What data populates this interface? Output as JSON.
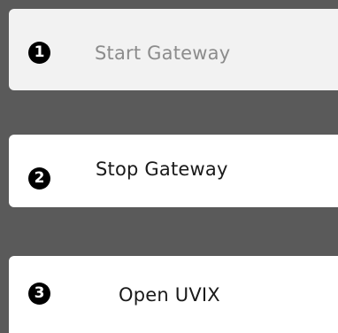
{
  "buttons": [
    {
      "badge": "1",
      "label": "Start Gateway",
      "state": "disabled"
    },
    {
      "badge": "2",
      "label": "Stop Gateway",
      "state": "enabled"
    },
    {
      "badge": "3",
      "label": "Open UVIX",
      "state": "enabled"
    }
  ],
  "colors": {
    "background": "#5a5a5a",
    "button_disabled_bg": "#f2f2f2",
    "button_enabled_bg": "#ffffff",
    "disabled_text": "#8c8c8c",
    "enabled_text": "#1a1a1a",
    "badge_bg": "#000000"
  }
}
